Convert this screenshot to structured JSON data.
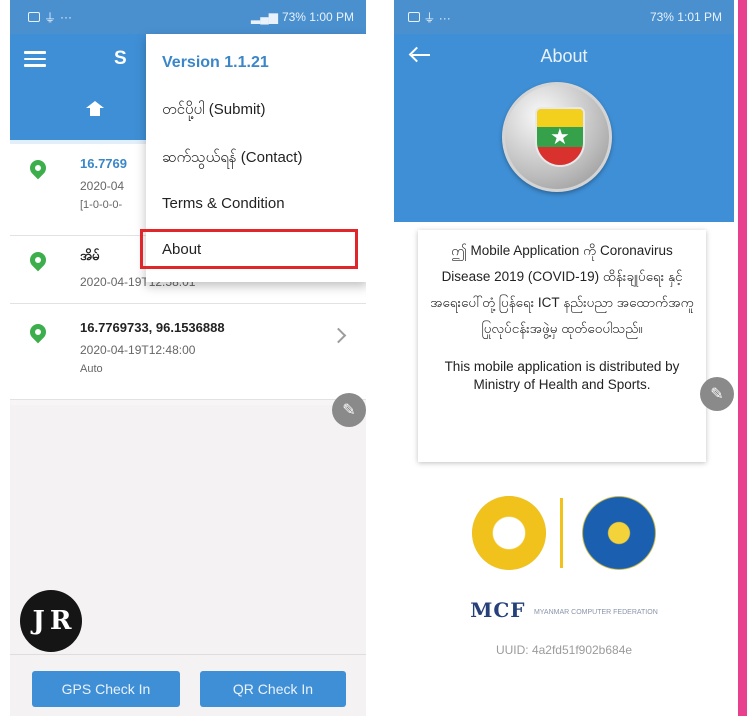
{
  "left_screen": {
    "status_bar": {
      "icons_left": "settings usb wifi ...",
      "right_text": "73% 1:00 PM"
    },
    "app_bar": {
      "title_fragment": "S",
      "menu_icon": "hamburger-icon"
    },
    "tab": {
      "icon": "home-icon"
    },
    "list": [
      {
        "coord": "16.7769",
        "time": "2020-04",
        "sub": "[1-0-0-0-",
        "highlight": true
      },
      {
        "coord": "အိမ်",
        "time": "2020-04-19T12:58:01",
        "sub": ""
      },
      {
        "coord": "16.7769733, 96.1536888",
        "time": "2020-04-19T12:48:00",
        "sub": "Auto"
      }
    ],
    "overflow_menu": {
      "version": "Version 1.1.21",
      "submit": "တင်ပို့ပါ (Submit)",
      "contact": "ဆက်သွယ်ရန် (Contact)",
      "terms": "Terms & Condition",
      "about": "About"
    },
    "buttons": {
      "gps": "GPS Check In",
      "qr": "QR Check In"
    },
    "watermark": "J R"
  },
  "right_screen": {
    "status_bar": {
      "right_text": "73% 1:01 PM"
    },
    "app_bar": {
      "title": "About"
    },
    "description_mm": "ဤ Mobile Application ကို Coronavirus Disease 2019 (COVID-19) ထိန်းချုပ်ရေး နှင့် အရေးပေါ်တုံ့ပြန်ရေး ICT နည်းပညာ အထောက်အကူပြုလုပ်ငန်းအဖွဲ့မှ ထုတ်ဝေပါသည်။",
    "description_en": "This mobile application is distributed by Ministry of Health and Sports.",
    "mcf_logo": "MCF",
    "mcf_sub": "MYANMAR COMPUTER FEDERATION",
    "uuid": "UUID: 4a2fd51f902b684e"
  },
  "colors": {
    "primary": "#3f8fd6",
    "highlight_border": "#e0262b",
    "pin": "#3cae4b",
    "side_strip": "#e8408f"
  }
}
